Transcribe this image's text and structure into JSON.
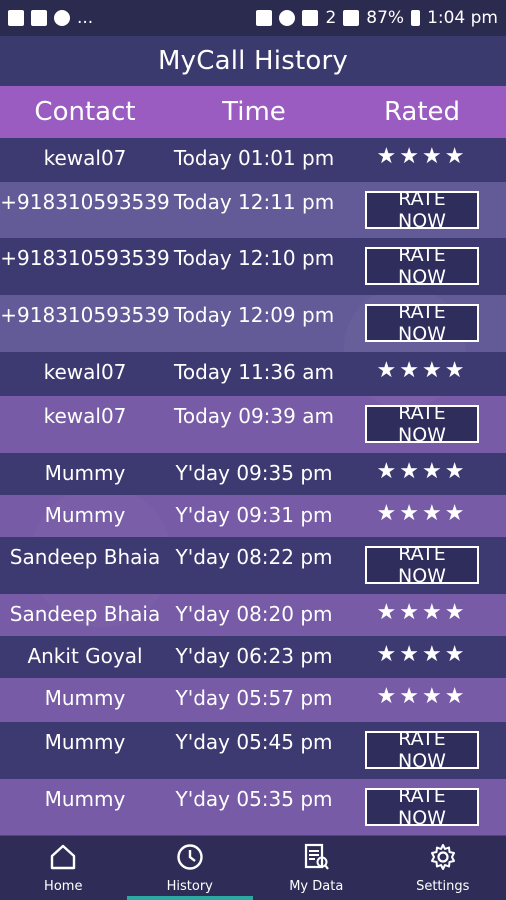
{
  "status": {
    "battery": "87%",
    "time": "1:04 pm",
    "sim": "2",
    "more": "..."
  },
  "app": {
    "title": "MyCall History"
  },
  "columns": {
    "contact": "Contact",
    "time": "Time",
    "rated": "Rated"
  },
  "rate_label": "RATE NOW",
  "rows": [
    {
      "contact": "kewal07",
      "time": "Today 01:01 pm",
      "rating": "★★★★",
      "action": ""
    },
    {
      "contact": "+918310593539",
      "time": "Today 12:11 pm",
      "rating": "",
      "action": "RATE NOW"
    },
    {
      "contact": "+918310593539",
      "time": "Today 12:10 pm",
      "rating": "",
      "action": "RATE NOW"
    },
    {
      "contact": "+918310593539",
      "time": "Today 12:09 pm",
      "rating": "",
      "action": "RATE NOW"
    },
    {
      "contact": "kewal07",
      "time": "Today 11:36 am",
      "rating": "★★★★",
      "action": ""
    },
    {
      "contact": "kewal07",
      "time": "Today 09:39 am",
      "rating": "",
      "action": "RATE NOW"
    },
    {
      "contact": "Mummy",
      "time": "Y'day 09:35 pm",
      "rating": "★★★★",
      "action": ""
    },
    {
      "contact": "Mummy",
      "time": "Y'day 09:31 pm",
      "rating": "★★★★",
      "action": ""
    },
    {
      "contact": "Sandeep Bhaia",
      "time": "Y'day 08:22 pm",
      "rating": "",
      "action": "RATE NOW"
    },
    {
      "contact": "Sandeep Bhaia",
      "time": "Y'day 08:20 pm",
      "rating": "★★★★",
      "action": ""
    },
    {
      "contact": "Ankit Goyal",
      "time": "Y'day 06:23 pm",
      "rating": "★★★★",
      "action": ""
    },
    {
      "contact": "Mummy",
      "time": "Y'day 05:57 pm",
      "rating": "★★★★",
      "action": ""
    },
    {
      "contact": "Mummy",
      "time": "Y'day 05:45 pm",
      "rating": "",
      "action": "RATE NOW"
    },
    {
      "contact": "Mummy",
      "time": "Y'day 05:35 pm",
      "rating": "",
      "action": "RATE NOW"
    }
  ],
  "nav": [
    {
      "label": "Home",
      "icon": "home-icon",
      "active": false
    },
    {
      "label": "History",
      "icon": "clock-icon",
      "active": true
    },
    {
      "label": "My Data",
      "icon": "data-document-icon",
      "active": false
    },
    {
      "label": "Settings",
      "icon": "gear-icon",
      "active": false
    }
  ],
  "colors": {
    "header_bar": "#3b3a6e",
    "column_header": "#9a5cc0",
    "nav_active": "#2aa9a2"
  }
}
